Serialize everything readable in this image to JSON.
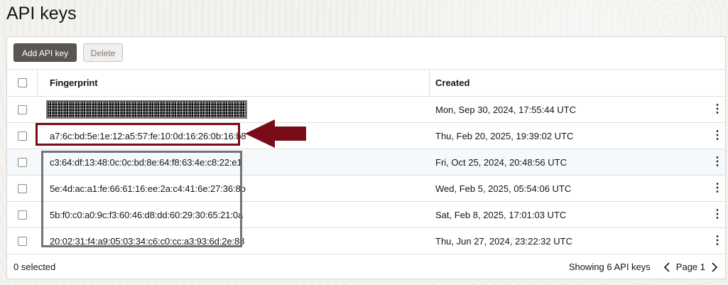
{
  "page": {
    "title": "API keys"
  },
  "toolbar": {
    "add_label": "Add API key",
    "delete_label": "Delete"
  },
  "table": {
    "columns": {
      "fingerprint": "Fingerprint",
      "created": "Created"
    },
    "rows": [
      {
        "fingerprint": "",
        "redacted": true,
        "created": "Mon, Sep 30, 2024, 17:55:44 UTC"
      },
      {
        "fingerprint": "a7:6c:bd:5e:1e:12:a5:57:fe:10:0d:16:26:0b:16:b8",
        "created": "Thu, Feb 20, 2025, 19:39:02 UTC"
      },
      {
        "fingerprint": "c3:64:df:13:48:0c:0c:bd:8e:64:f8:63:4e:c8:22:e1",
        "created": "Fri, Oct 25, 2024, 20:48:56 UTC"
      },
      {
        "fingerprint": "5e:4d:ac:a1:fe:66:61:16:ee:2a:c4:41:6e:27:36:8b",
        "created": "Wed, Feb 5, 2025, 05:54:06 UTC"
      },
      {
        "fingerprint": "5b:f0:c0:a0:9c:f3:60:46:d8:dd:60:29:30:65:21:0a",
        "created": "Sat, Feb 8, 2025, 17:01:03 UTC"
      },
      {
        "fingerprint": "20:02:31:f4:a9:05:03:34:c6:c0:cc:a3:93:6d:2e:88",
        "created": "Thu, Jun 27, 2024, 23:22:32 UTC"
      }
    ]
  },
  "footer": {
    "selected": "0 selected",
    "showing": "Showing 6 API keys",
    "page": "Page 1"
  },
  "colors": {
    "primary_button": "#5b5652",
    "annotation_red": "#7a0b18",
    "annotation_gray": "#757370"
  }
}
